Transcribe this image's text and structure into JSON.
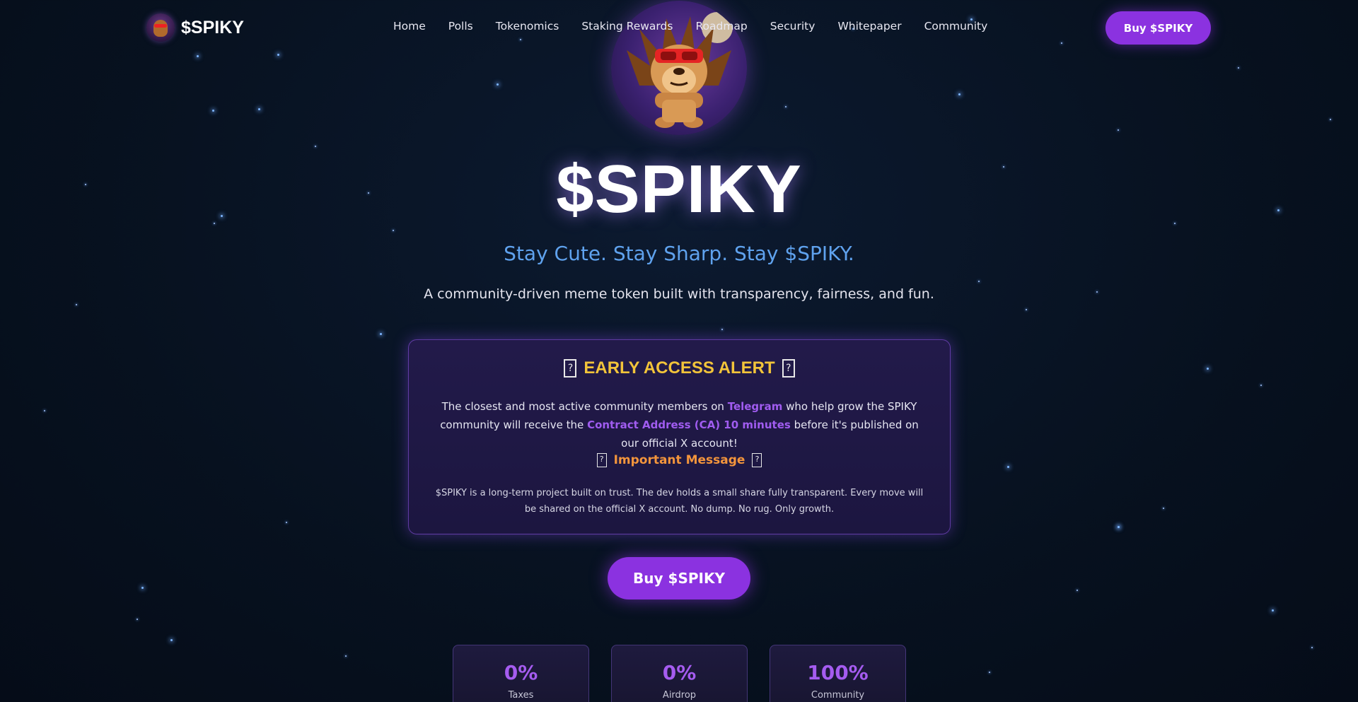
{
  "nav": {
    "brand": "$SPIKY",
    "items": [
      "Home",
      "Polls",
      "Tokenomics",
      "Staking Rewards",
      "Roadmap",
      "Security",
      "Whitepaper",
      "Community"
    ],
    "buy_label": "Buy $SPIKY"
  },
  "hero": {
    "title": "$SPIKY",
    "tagline": "Stay Cute. Stay Sharp. Stay $SPIKY.",
    "subtitle": "A community-driven meme token built with transparency, fairness, and fun."
  },
  "alert": {
    "icon_glyph": "?",
    "title": "EARLY ACCESS ALERT",
    "body_1": "The closest and most active community members on ",
    "body_link_1": "Telegram",
    "body_2": " who help grow the SPIKY community will receive the ",
    "body_link_2": "Contract Address (CA) 10 minutes",
    "body_3": " before it's published on our official X account!",
    "important_title": "Important Message",
    "important_body": "$SPIKY is a long-term project built on trust. The dev holds a small share fully transparent. Every move will be shared on the official X account. No dump. No rug. Only growth."
  },
  "cta": {
    "label": "Buy $SPIKY"
  },
  "stats": [
    {
      "value": "0%",
      "label": "Taxes"
    },
    {
      "value": "0%",
      "label": "Airdrop"
    },
    {
      "value": "100%",
      "label": "Community"
    }
  ],
  "colors": {
    "accent": "#8b32e0",
    "tagline": "#5fa2ee",
    "alert_title": "#f2c43a",
    "important_title": "#f3953c",
    "stat_value": "#a55cf0"
  },
  "icons": {
    "brand": "hedgehog-logo-icon",
    "mascot": "hedgehog-mascot-icon",
    "alert": "missing-glyph-icon"
  }
}
